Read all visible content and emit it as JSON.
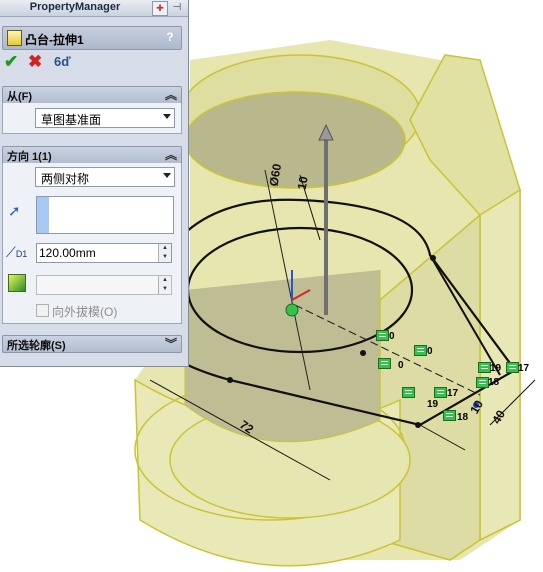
{
  "property_manager": {
    "title": "PropertyManager",
    "feature_title": "凸台-拉伸1",
    "help": "?",
    "ok_label": "✔",
    "cancel_label": "✖",
    "preview_label": "6ď",
    "from_group": {
      "label": "从(F)",
      "selected": "草图基准面"
    },
    "direction_group": {
      "label": "方向 1(1)",
      "end_condition": "两侧对称",
      "depth": "120.00mm",
      "depth_icon_label": "D1",
      "draft_outward_label": "向外拔模(O)",
      "draft_outward_checked": false
    },
    "selected_contours_group": {
      "label": "所选轮廓(S)"
    }
  },
  "viewport": {
    "dimensions": [
      "Ø60",
      "10",
      "72",
      "10",
      "40"
    ],
    "relations": [
      "0",
      "0",
      "0",
      "19",
      "17",
      "18",
      "17",
      "19",
      "18"
    ]
  },
  "colors": {
    "model_fill": "#e2e2a2",
    "model_edge": "#c9c435",
    "panel_bg": "#d6dde8",
    "relation_green": "#35c24a"
  }
}
